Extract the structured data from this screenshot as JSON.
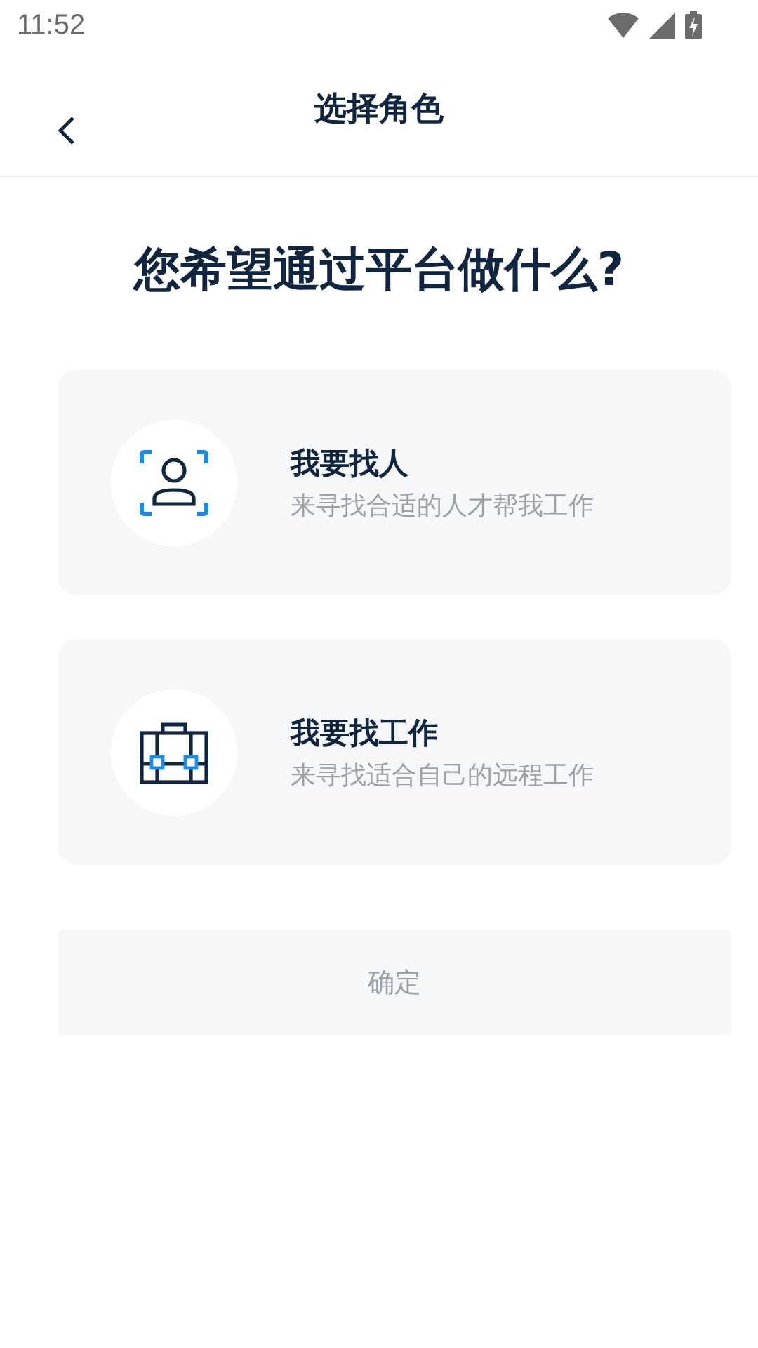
{
  "status_bar": {
    "time": "11:52"
  },
  "header": {
    "title": "选择角色"
  },
  "question": "您希望通过平台做什么?",
  "options": [
    {
      "kind": "person",
      "title": "我要找人",
      "subtitle": "来寻找合适的人才帮我工作",
      "selected": false
    },
    {
      "kind": "job",
      "title": "我要找工作",
      "subtitle": "来寻找适合自己的远程工作",
      "selected": false
    }
  ],
  "confirm_button": {
    "label": "确定",
    "disabled": true
  }
}
